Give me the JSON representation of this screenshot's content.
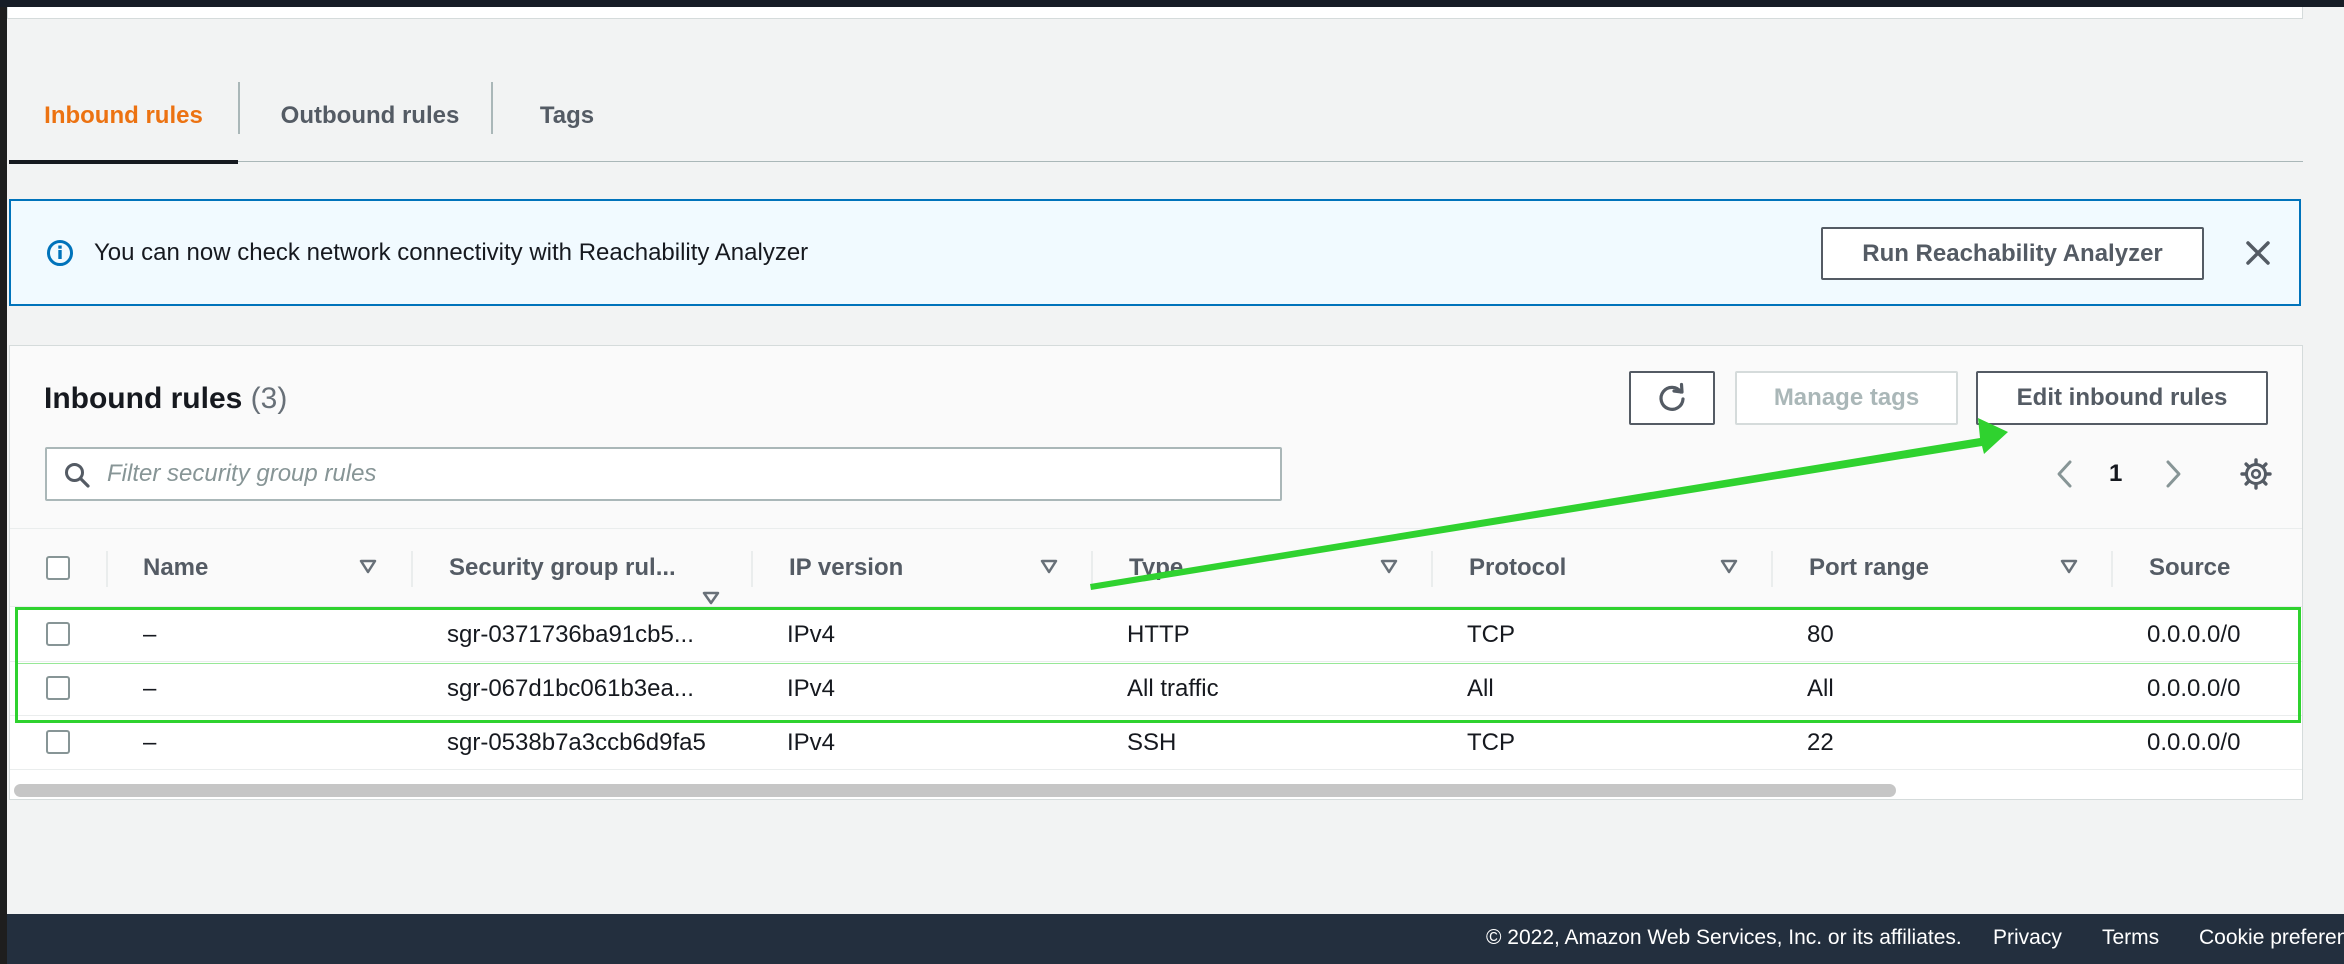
{
  "tabs": [
    {
      "label": "Inbound rules",
      "active": true
    },
    {
      "label": "Outbound rules",
      "active": false
    },
    {
      "label": "Tags",
      "active": false
    }
  ],
  "banner": {
    "text": "You can now check network connectivity with Reachability Analyzer",
    "button_label": "Run Reachability Analyzer",
    "icon": "info-icon",
    "close_icon": "close-icon"
  },
  "panel": {
    "title": "Inbound rules",
    "count": "(3)",
    "refresh_icon": "refresh-icon",
    "manage_tags_label": "Manage tags",
    "edit_label": "Edit inbound rules",
    "search_placeholder": "Filter security group rules",
    "search_value": "",
    "page": "1"
  },
  "table": {
    "columns": [
      "Name",
      "Security group rul...",
      "IP version",
      "Type",
      "Protocol",
      "Port range",
      "Source"
    ],
    "rows": [
      {
        "name": "–",
        "rule_id": "sgr-0371736ba91cb5...",
        "ip_version": "IPv4",
        "type": "HTTP",
        "protocol": "TCP",
        "port_range": "80",
        "source": "0.0.0.0/0"
      },
      {
        "name": "–",
        "rule_id": "sgr-067d1bc061b3ea...",
        "ip_version": "IPv4",
        "type": "All traffic",
        "protocol": "All",
        "port_range": "All",
        "source": "0.0.0.0/0"
      },
      {
        "name": "–",
        "rule_id": "sgr-0538b7a3ccb6d9fa5",
        "ip_version": "IPv4",
        "type": "SSH",
        "protocol": "TCP",
        "port_range": "22",
        "source": "0.0.0.0/0"
      }
    ]
  },
  "footer": {
    "copyright": "© 2022, Amazon Web Services, Inc. or its affiliates.",
    "privacy": "Privacy",
    "terms": "Terms",
    "cookie": "Cookie preferen"
  },
  "colors": {
    "accent_tab": "#ec7211",
    "info_border": "#0073bb",
    "annotation": "#2fd22f",
    "footer_bg": "#232f3e"
  }
}
